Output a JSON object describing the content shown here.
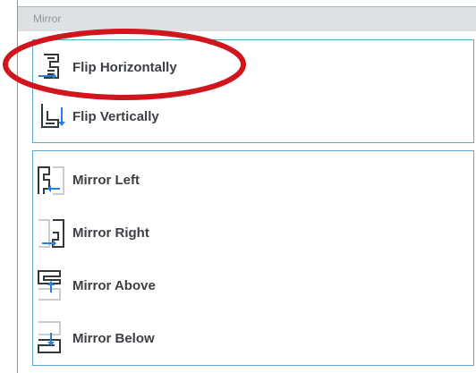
{
  "panel": {
    "title": "Mirror"
  },
  "flip_group": {
    "items": [
      {
        "label": "Flip Horizontally",
        "icon": "flip-horizontal-icon"
      },
      {
        "label": "Flip Vertically",
        "icon": "flip-vertical-icon"
      }
    ]
  },
  "mirror_group": {
    "items": [
      {
        "label": "Mirror Left",
        "icon": "mirror-left-icon"
      },
      {
        "label": "Mirror Right",
        "icon": "mirror-right-icon"
      },
      {
        "label": "Mirror Above",
        "icon": "mirror-above-icon"
      },
      {
        "label": "Mirror Below",
        "icon": "mirror-below-icon"
      }
    ]
  },
  "colors": {
    "border": "#5aa6cc",
    "highlight": "#d0161c",
    "accent_arrow": "#2a7fd4"
  }
}
